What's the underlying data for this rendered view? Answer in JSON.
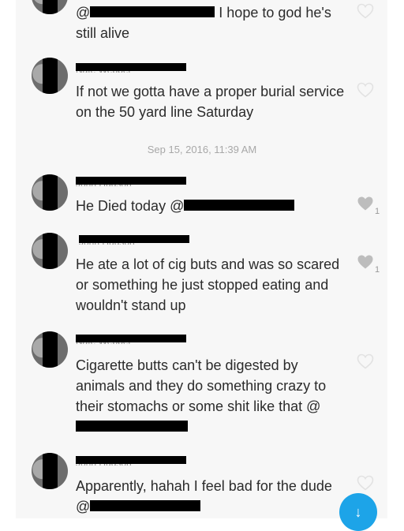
{
  "messages": [
    {
      "id": "m0",
      "mention_prefix": "@",
      "text_after_mention": "I hope to god he's",
      "text_line2": "still alive",
      "liked": false
    },
    {
      "id": "m1",
      "author": "Nate Webber",
      "text": "If not we gotta have a proper burial service on the 50 yard line Saturday",
      "liked": false
    },
    {
      "id": "timestamp",
      "text": "Sep 15, 2016, 11:39 AM"
    },
    {
      "id": "m2",
      "author": "John Hudson",
      "text_before_mention": "He Died today",
      "mention_prefix": "@",
      "liked": true,
      "likes": "1"
    },
    {
      "id": "m3",
      "author": "John Hudson",
      "text": "He ate a lot of cig buts and was so scared or something he just stopped eating and wouldn't stand up",
      "liked": true,
      "likes": "1"
    },
    {
      "id": "m4",
      "author": "Nate Webber",
      "text_before_mention": "Cigarette butts can't be digested by animals and they do something crazy to their stomachs or some shit like that",
      "mention_prefix": "@",
      "liked": false
    },
    {
      "id": "m5",
      "author": "John Hudson",
      "text_before_mention": "Apparently, hahah I feel bad for the dude",
      "mention_prefix": "@",
      "liked": false
    }
  ],
  "scroll_button": {
    "icon": "arrow-down-icon",
    "glyph": "↓"
  },
  "colors": {
    "accent": "#1da4e8",
    "heart_empty": "#e2e2e2",
    "heart_full": "#bdbdbd",
    "redaction": "#000000"
  }
}
